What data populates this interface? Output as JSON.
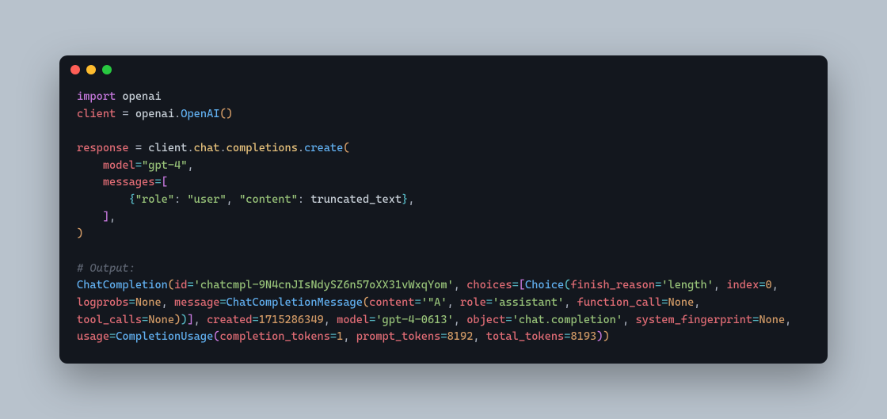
{
  "code": {
    "line1": {
      "kw": "import",
      "mod": " openai"
    },
    "line2": {
      "var": "client",
      "eq": " = ",
      "mod": "openai",
      "dot": ".",
      "func": "OpenAI",
      "paren": "()"
    },
    "line4": {
      "var": "response",
      "eq": " = ",
      "client": "client",
      "d1": ".",
      "chat": "chat",
      "d2": ".",
      "comp": "completions",
      "d3": ".",
      "create": "create",
      "open": "("
    },
    "line5": {
      "indent": "    ",
      "model_kw": "model",
      "eq": "=",
      "model_val": "\"gpt-4\"",
      "comma": ","
    },
    "line6": {
      "indent": "    ",
      "msgs_kw": "messages",
      "eq": "=",
      "open": "["
    },
    "line7": {
      "indent": "        ",
      "open": "{",
      "role_k": "\"role\"",
      "colon1": ": ",
      "role_v": "\"user\"",
      "comma1": ", ",
      "cont_k": "\"content\"",
      "colon2": ": ",
      "cont_v": "truncated_text",
      "close": "}",
      "comma2": ","
    },
    "line8": {
      "indent": "    ",
      "close": "]",
      "comma": ","
    },
    "line9": {
      "close": ")"
    },
    "comment": "# Output:",
    "out": {
      "ChatCompletion": "ChatCompletion",
      "open": "(",
      "id_k": "id",
      "eq": "=",
      "id_v": "'chatcmpl-9N4cnJIsNdySZ6n57oXX31vWxqYom'",
      "choices_k": "choices",
      "Choice": "Choice",
      "finish_k": "finish_reason",
      "finish_v": "'length'",
      "index_k": "index",
      "index_v": "0",
      "logprobs_k": "logprobs",
      "none": "None",
      "message_k": "message",
      "CCM": "ChatCompletionMessage",
      "content_k": "content",
      "content_v": "'\"A'",
      "role_k": "role",
      "role_v": "'assistant'",
      "fc_k": "function_call",
      "tc_k": "tool_calls",
      "created_k": "created",
      "created_v": "1715286349",
      "model_k": "model",
      "model_v": "'gpt-4-0613'",
      "object_k": "object",
      "object_v": "'chat.completion'",
      "sf_k": "system_fingerprint",
      "usage_k": "usage",
      "CU": "CompletionUsage",
      "ct_k": "completion_tokens",
      "ct_v": "1",
      "pt_k": "prompt_tokens",
      "pt_v": "8192",
      "tt_k": "total_tokens",
      "tt_v": "8193",
      "comma": ", "
    }
  }
}
